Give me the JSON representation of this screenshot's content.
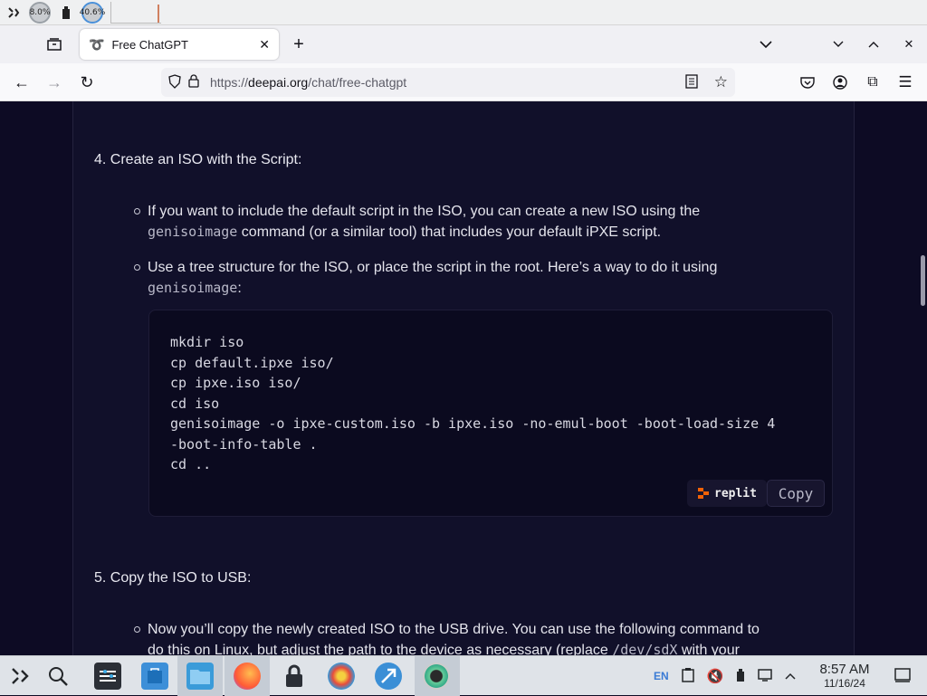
{
  "system_panel": {
    "cpu_gauge": "8.0%",
    "mem_gauge": "40.6%"
  },
  "browser": {
    "tab_title": "Free ChatGPT",
    "url_prefix": "https://",
    "url_host": "deepai.org",
    "url_path": "/chat/free-chatgpt"
  },
  "article": {
    "step4_heading": "4. Create an ISO with the Script:",
    "bullet1_part1": "If you want to include the default script in the ISO, you can create a new ISO using the",
    "bullet1_code": "genisoimage",
    "bullet1_part2": " command (or a similar tool) that includes your default iPXE script.",
    "bullet2_part1": "Use a tree structure for the ISO, or place the script in the root. Here’s a way to do it using",
    "bullet2_code": "genisoimage",
    "bullet2_part2": ":",
    "code_block": "mkdir iso\ncp default.ipxe iso/\ncp ipxe.iso iso/\ncd iso\ngenisoimage -o ipxe-custom.iso -b ipxe.iso -no-emul-boot -boot-load-size 4\n-boot-info-table .\ncd ..",
    "replit_label": "replit",
    "copy_label": "Copy",
    "step5_heading": "5. Copy the ISO to USB:",
    "bullet3_part1": "Now you’ll copy the newly created ISO to the USB drive. You can use the following command to",
    "bullet3_part2": "do this on Linux, but adjust the path to the device as necessary (replace ",
    "bullet3_code": "/dev/sdX",
    "bullet3_part3": " with your"
  },
  "taskbar": {
    "language": "EN",
    "time": "8:57 AM",
    "date": "11/16/24"
  }
}
